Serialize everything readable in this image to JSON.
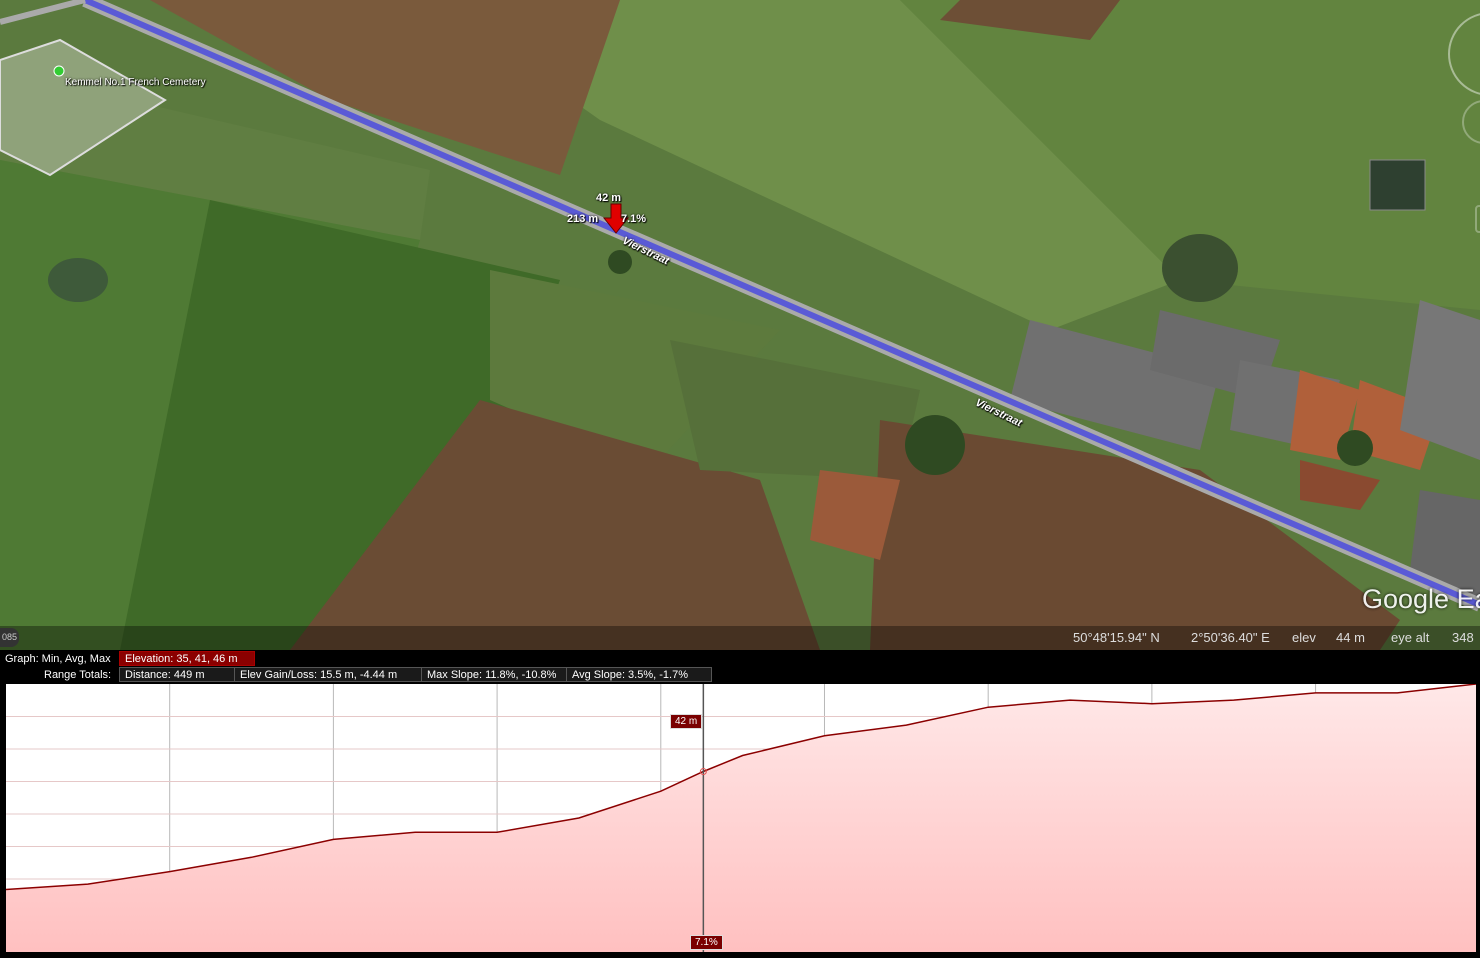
{
  "map": {
    "place_label": "Kemmel No.1 French Cemetery",
    "road_labels": [
      "Vierstraat",
      "Vierstraat"
    ],
    "marker": {
      "elevation": "42 m",
      "distance": "213 m",
      "slope": "7.1%"
    },
    "status": {
      "left_counter": "085",
      "lat": "50°48'15.94\" N",
      "lon": "2°50'36.40\" E",
      "elev_label": "elev",
      "elev_value": "44 m",
      "eye_label": "eye alt",
      "eye_value": "348"
    },
    "logo": "Google Ea",
    "colors": {
      "route": "#5a5ad6",
      "marker": "#e00000"
    }
  },
  "stats": {
    "graph_label": "Graph: Min, Avg, Max",
    "elevation": "Elevation: 35, 41, 46 m",
    "range_label": "Range Totals:",
    "distance": "Distance: 449 m",
    "gain_loss": "Elev Gain/Loss: 15.5 m, -4.44 m",
    "max_slope": "Max Slope: 11.8%, -10.8%",
    "avg_slope": "Avg Slope: 3.5%, -1.7%"
  },
  "graph": {
    "cursor_elevation": "42 m",
    "cursor_slope": "7.1%"
  },
  "chart_data": {
    "type": "area",
    "x": [
      0,
      25,
      50,
      75,
      100,
      125,
      150,
      175,
      200,
      213,
      225,
      250,
      275,
      300,
      325,
      350,
      375,
      400,
      425,
      449
    ],
    "values": [
      35.0,
      35.3,
      36.0,
      36.8,
      37.8,
      38.2,
      38.2,
      39.0,
      40.5,
      41.6,
      42.5,
      43.6,
      44.2,
      45.2,
      45.6,
      45.4,
      45.6,
      46.0,
      46.0,
      46.5
    ],
    "xlabel": "",
    "ylabel": "",
    "xlim": [
      0,
      449
    ],
    "ylim": [
      31.5,
      46.5
    ],
    "grid": true,
    "series_color": "#8b0000",
    "fill_color": "#ffc8c8"
  }
}
